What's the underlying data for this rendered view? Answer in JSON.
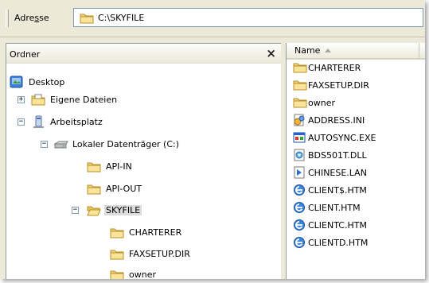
{
  "address": {
    "label_before": "Adre",
    "label_underlined": "s",
    "label_after": "se",
    "path": "C:\\SKYFILE"
  },
  "folders_pane": {
    "title": "Ordner",
    "close_glyph": "×",
    "expand_glyph": "+",
    "collapse_glyph": "−",
    "items": [
      {
        "label": "Desktop"
      },
      {
        "label": "Eigene Dateien"
      },
      {
        "label": "Arbeitsplatz"
      },
      {
        "label": "Lokaler Datenträger (C:)"
      },
      {
        "label": "API-IN"
      },
      {
        "label": "API-OUT"
      },
      {
        "label": "SKYFILE"
      },
      {
        "label": "CHARTERER"
      },
      {
        "label": "FAXSETUP.DIR"
      },
      {
        "label": "owner"
      }
    ]
  },
  "files_pane": {
    "column_name": "Name",
    "files": [
      {
        "label": "CHARTERER",
        "icon": "folder-icon"
      },
      {
        "label": "FAXSETUP.DIR",
        "icon": "folder-icon"
      },
      {
        "label": "owner",
        "icon": "folder-icon"
      },
      {
        "label": "ADDRESS.INI",
        "icon": "ini-settings-icon"
      },
      {
        "label": "AUTOSYNC.EXE",
        "icon": "exe-app-icon"
      },
      {
        "label": "BDS501T.DLL",
        "icon": "dll-icon"
      },
      {
        "label": "CHINESE.LAN",
        "icon": "lan-file-icon"
      },
      {
        "label": "CLIENT$.HTM",
        "icon": "htm-ie-icon"
      },
      {
        "label": "CLIENT.HTM",
        "icon": "htm-ie-icon"
      },
      {
        "label": "CLIENTC.HTM",
        "icon": "htm-ie-icon"
      },
      {
        "label": "CLIENTD.HTM",
        "icon": "htm-ie-icon"
      }
    ]
  }
}
